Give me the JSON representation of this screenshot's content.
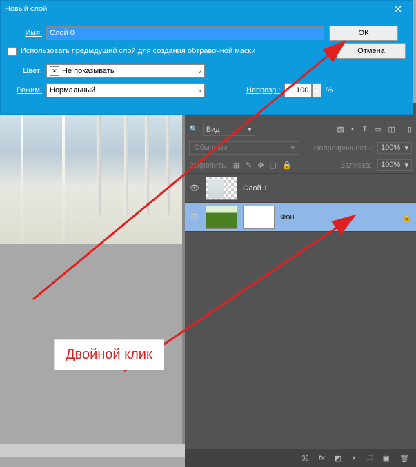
{
  "dialog": {
    "title": "Новый слой",
    "name_label": "Имя:",
    "name_value": "Слой 0",
    "use_prev_label": "Использовать предыдущий слой для создания обтравочной маски",
    "color_label": "Цвет:",
    "color_value": "Не показывать",
    "mode_label": "Режим:",
    "mode_value": "Нормальный",
    "opacity_label": "Непрозр.:",
    "opacity_value": "100",
    "opacity_unit": "%",
    "ok": "ОК",
    "cancel": "Отмена"
  },
  "panel": {
    "tab": "Слои",
    "filter_kind": "Вид",
    "blend_mode": "Обычные",
    "opacity_label": "Непрозрачность:",
    "opacity_value": "100%",
    "lock_label": "Закрепить:",
    "fill_label": "Заливка:",
    "fill_value": "100%",
    "layers": [
      {
        "name": "Слой 1"
      },
      {
        "name": "Фон"
      }
    ]
  },
  "annotation": "Двойной клик"
}
